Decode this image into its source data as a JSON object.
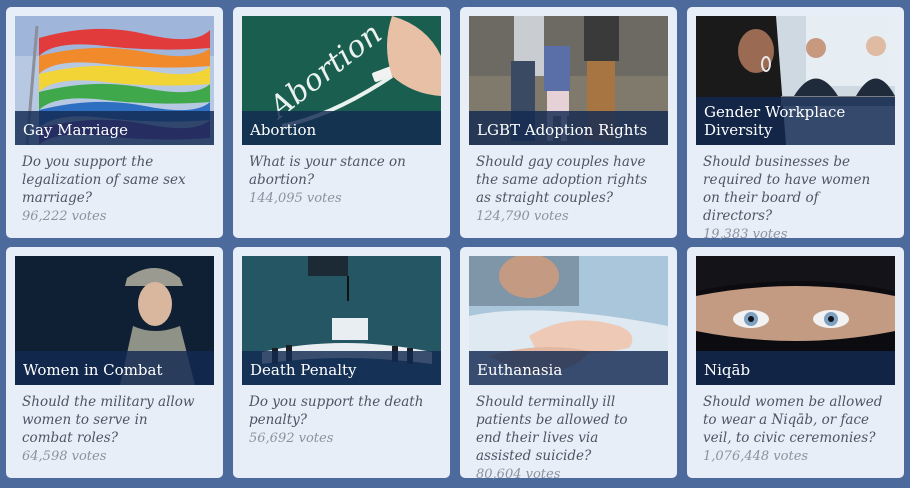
{
  "polls": [
    {
      "title": "Gay Marriage",
      "question": "Do you support the legalization of same sex marriage?",
      "votes": "96,222 votes"
    },
    {
      "title": "Abortion",
      "question": "What is your stance on abortion?",
      "votes": "144,095 votes",
      "image_text": "Abortion"
    },
    {
      "title": "LGBT Adoption Rights",
      "question": "Should gay couples have the same adoption rights as straight couples?",
      "votes": "124,790 votes"
    },
    {
      "title": "Gender Workplace Diversity",
      "question": "Should businesses be required to have women on their board of directors?",
      "votes": "19,383 votes"
    },
    {
      "title": "Women in Combat",
      "question": "Should the military allow women to serve in combat roles?",
      "votes": "64,598 votes"
    },
    {
      "title": "Death Penalty",
      "question": "Do you support the death penalty?",
      "votes": "56,692 votes"
    },
    {
      "title": "Euthanasia",
      "question": "Should terminally ill patients be allowed to end their lives via assisted suicide?",
      "votes": "80,604 votes"
    },
    {
      "title": "Niqāb",
      "question": "Should women be allowed to wear a Niqāb, or face veil, to civic ceremonies?",
      "votes": "1,076,448 votes"
    }
  ],
  "colors": {
    "page_background": "#4c6a9c",
    "card_background": "#e8eef7",
    "title_bar": "#122a52"
  }
}
